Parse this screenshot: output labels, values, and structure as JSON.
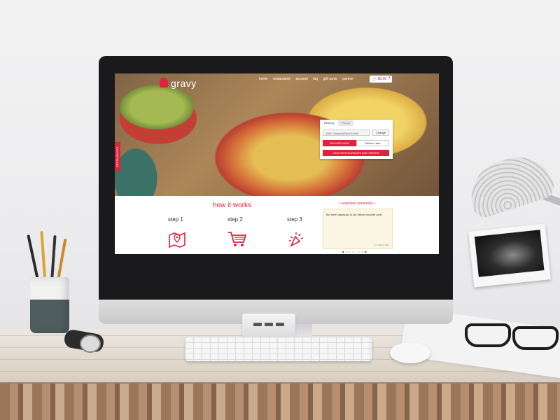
{
  "header": {
    "logo": "gravy",
    "nav": [
      "home",
      "restaurants",
      "account",
      "faq",
      "gift cards",
      "partner"
    ],
    "cart_total": "$0.00"
  },
  "side_tab": "RESTAURANTS",
  "order_panel": {
    "tabs": [
      "Delivery",
      "Pickup"
    ],
    "address": "1001 Chestnut Blvd 32402",
    "change_label": "Change",
    "deliver_now": "DELIVER NOW",
    "deliver_later": "Deliver Later",
    "view_button": "VIEW RESTAURANTS AND ORDER!"
  },
  "how_it_works": {
    "title": "how it works",
    "steps": [
      {
        "label": "step 1",
        "icon": "map-pin-icon"
      },
      {
        "label": "step 2",
        "icon": "shopping-cart-icon"
      },
      {
        "label": "step 3",
        "icon": "celebration-icon"
      }
    ]
  },
  "customer_comments": {
    "title": "customer comments",
    "comment": "the beef carpaccio is our offices favorite pick!",
    "time": "21 days ago"
  },
  "colors": {
    "accent": "#e0223d"
  }
}
